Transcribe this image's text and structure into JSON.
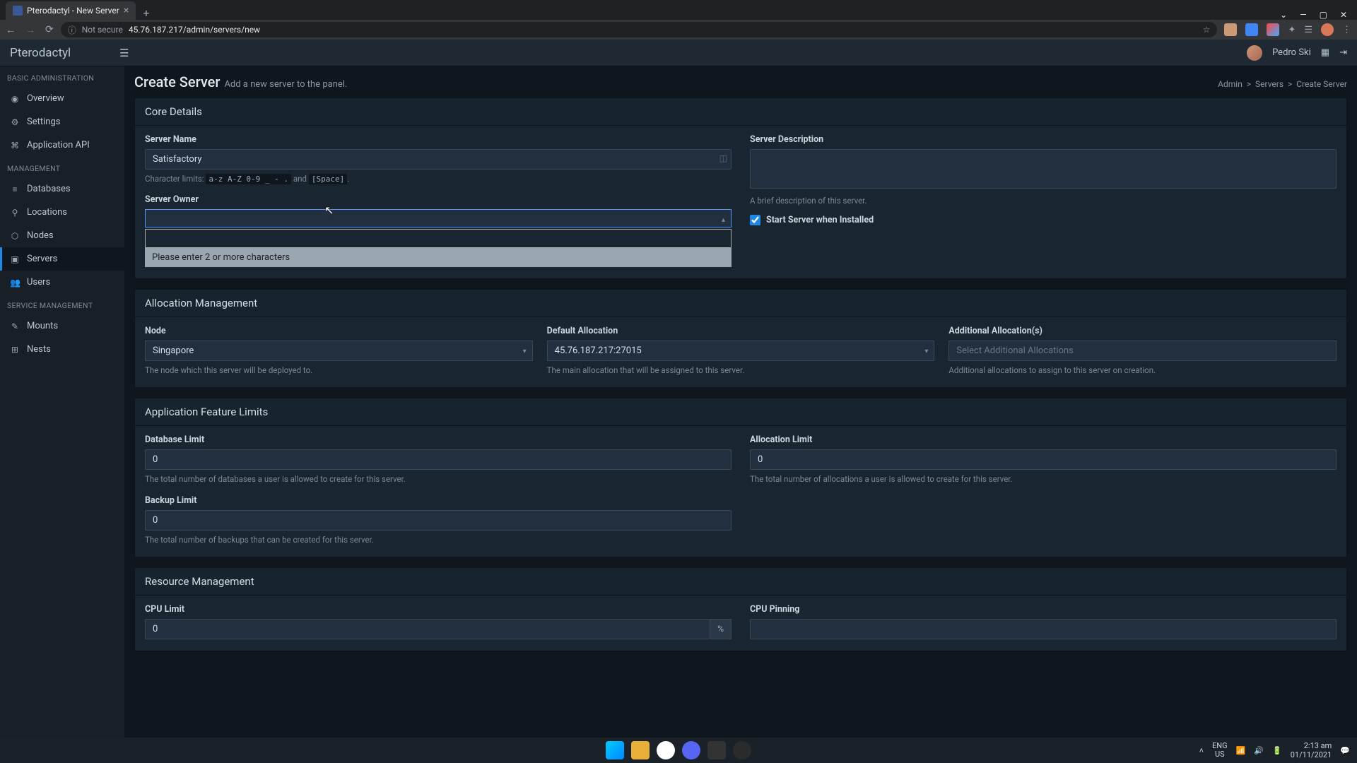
{
  "browser": {
    "tab_title": "Pterodactyl - New Server",
    "url_prefix": "Not secure",
    "url": "45.76.187.217/admin/servers/new",
    "lang": "ENG",
    "region": "US",
    "clock_time": "2:13 am",
    "clock_date": "01/11/2021"
  },
  "header": {
    "brand": "Pterodactyl",
    "user_name": "Pedro Ski"
  },
  "sidebar": {
    "sections": [
      {
        "heading": "BASIC ADMINISTRATION",
        "items": [
          {
            "icon": "◉",
            "label": "Overview",
            "name": "overview"
          },
          {
            "icon": "⚙",
            "label": "Settings",
            "name": "settings"
          },
          {
            "icon": "⌘",
            "label": "Application API",
            "name": "application-api"
          }
        ]
      },
      {
        "heading": "MANAGEMENT",
        "items": [
          {
            "icon": "≡",
            "label": "Databases",
            "name": "databases"
          },
          {
            "icon": "⚲",
            "label": "Locations",
            "name": "locations"
          },
          {
            "icon": "⬡",
            "label": "Nodes",
            "name": "nodes"
          },
          {
            "icon": "▣",
            "label": "Servers",
            "name": "servers",
            "active": true
          },
          {
            "icon": "👥",
            "label": "Users",
            "name": "users"
          }
        ]
      },
      {
        "heading": "SERVICE MANAGEMENT",
        "items": [
          {
            "icon": "✎",
            "label": "Mounts",
            "name": "mounts"
          },
          {
            "icon": "⊞",
            "label": "Nests",
            "name": "nests"
          }
        ]
      }
    ]
  },
  "page": {
    "title": "Create Server",
    "subtitle": "Add a new server to the panel.",
    "breadcrumb": [
      "Admin",
      "Servers",
      "Create Server"
    ]
  },
  "core_details": {
    "heading": "Core Details",
    "server_name_label": "Server Name",
    "server_name_value": "Satisfactory",
    "char_limits_prefix": "Character limits:",
    "char_limits_code": "a-z A-Z 0-9 _ - .",
    "char_limits_and": " and ",
    "char_limits_space": "[Space]",
    "server_owner_label": "Server Owner",
    "owner_search_placeholder": "",
    "owner_search_msg": "Please enter 2 or more characters",
    "server_desc_label": "Server Description",
    "server_desc_help": "A brief description of this server.",
    "start_when_installed_label": "Start Server when Installed"
  },
  "allocation": {
    "heading": "Allocation Management",
    "node_label": "Node",
    "node_value": "Singapore",
    "node_help": "The node which this server will be deployed to.",
    "default_alloc_label": "Default Allocation",
    "default_alloc_value": "45.76.187.217:27015",
    "default_alloc_help": "The main allocation that will be assigned to this server.",
    "additional_label": "Additional Allocation(s)",
    "additional_placeholder": "Select Additional Allocations",
    "additional_help": "Additional allocations to assign to this server on creation."
  },
  "feature_limits": {
    "heading": "Application Feature Limits",
    "db_label": "Database Limit",
    "db_value": "0",
    "db_help": "The total number of databases a user is allowed to create for this server.",
    "alloc_label": "Allocation Limit",
    "alloc_value": "0",
    "alloc_help": "The total number of allocations a user is allowed to create for this server.",
    "backup_label": "Backup Limit",
    "backup_value": "0",
    "backup_help": "The total number of backups that can be created for this server."
  },
  "resource": {
    "heading": "Resource Management",
    "cpu_limit_label": "CPU Limit",
    "cpu_limit_value": "0",
    "cpu_limit_unit": "%",
    "cpu_pinning_label": "CPU Pinning"
  }
}
